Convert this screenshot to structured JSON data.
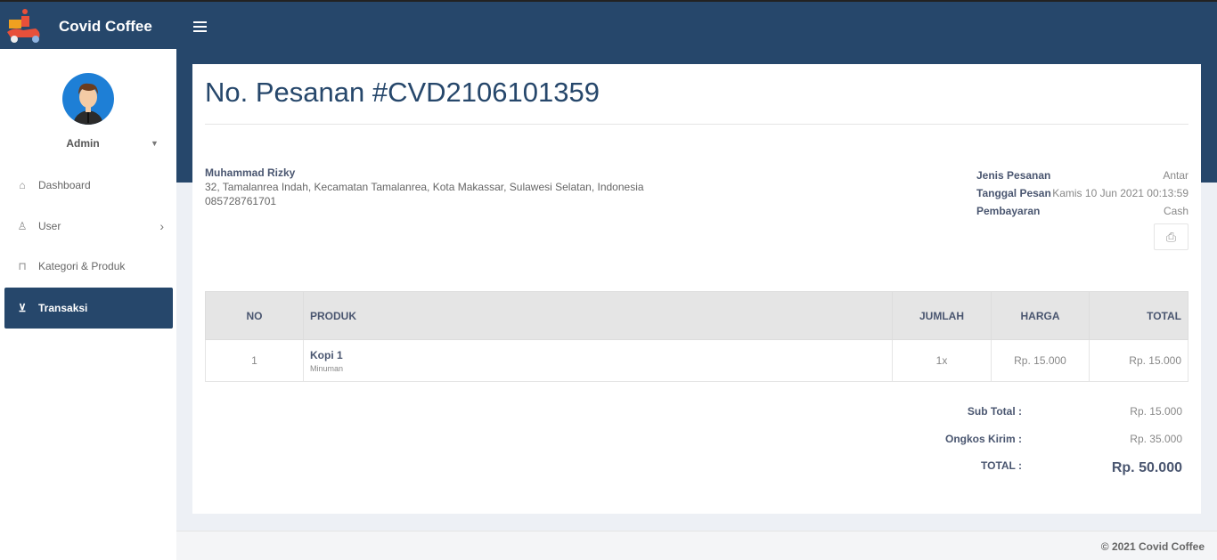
{
  "app": {
    "brand": "Covid Coffee"
  },
  "user": {
    "name": "Admin"
  },
  "sidebar": {
    "items": [
      {
        "label": "Dashboard",
        "icon": "home-icon"
      },
      {
        "label": "User",
        "icon": "users-icon"
      },
      {
        "label": "Kategori & Produk",
        "icon": "bag-icon"
      },
      {
        "label": "Transaksi",
        "icon": "cart-icon"
      }
    ]
  },
  "order": {
    "title": "No. Pesanan #CVD2106101359",
    "customer": {
      "name": "Muhammad Rizky",
      "address": "32, Tamalanrea Indah, Kecamatan Tamalanrea, Kota Makassar, Sulawesi Selatan, Indonesia",
      "phone": "085728761701"
    },
    "meta": [
      {
        "label": "Jenis Pesanan",
        "value": "Antar"
      },
      {
        "label": "Tanggal Pesan",
        "value": "Kamis 10 Jun 2021 00:13:59"
      },
      {
        "label": "Pembayaran",
        "value": "Cash"
      }
    ]
  },
  "table": {
    "headers": [
      "NO",
      "PRODUK",
      "JUMLAH",
      "HARGA",
      "TOTAL"
    ],
    "rows": [
      {
        "no": "1",
        "product": "Kopi 1",
        "category": "Minuman",
        "qty": "1x",
        "price": "Rp. 15.000",
        "total": "Rp. 15.000"
      }
    ]
  },
  "summary": {
    "subtotal_label": "Sub Total :",
    "subtotal": "Rp. 15.000",
    "shipping_label": "Ongkos Kirim :",
    "shipping": "Rp. 35.000",
    "total_label": "TOTAL :",
    "total": "Rp. 50.000"
  },
  "footer": "© 2021 Covid Coffee"
}
